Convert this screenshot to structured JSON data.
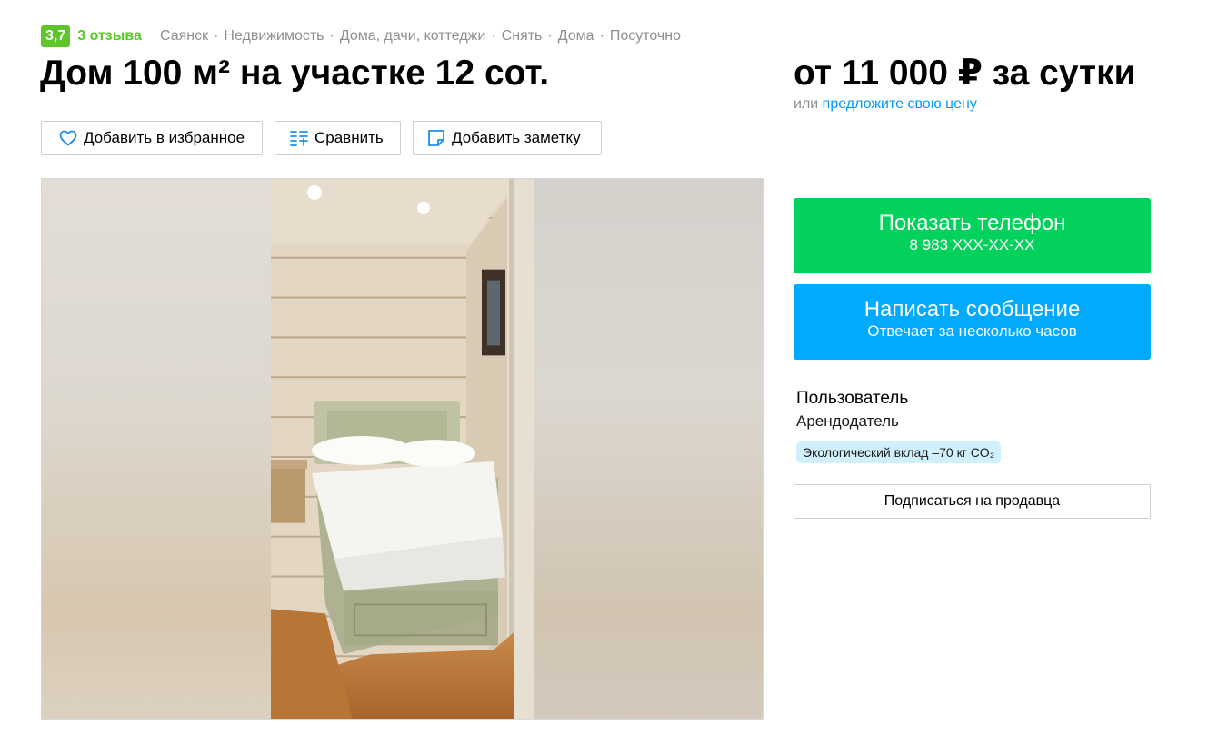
{
  "header": {
    "rating": "3,7",
    "reviews": "3 отзыва",
    "breadcrumbs": [
      "Саянск",
      "Недвижимость",
      "Дома, дачи, коттеджи",
      "Снять",
      "Дома",
      "Посуточно"
    ],
    "breadcrumb_separator": "·",
    "title": "Дом 100 м² на участке 12 сот."
  },
  "price": {
    "main": "от 11 000 ₽ за сутки",
    "or_text": "или",
    "offer_link": "предложите свою цену"
  },
  "actions": {
    "favorite": "Добавить в избранное",
    "compare": "Сравнить",
    "note": "Добавить заметку"
  },
  "contact": {
    "phone_label": "Показать телефон",
    "phone_number": "8 983 XXX-XX-XX",
    "message_label": "Написать сообщение",
    "message_sub": "Отвечает за несколько часов"
  },
  "seller": {
    "name": "Пользователь",
    "role": "Арендодатель",
    "eco_badge": "Экологический вклад –70 кг CO₂",
    "subscribe": "Подписаться на продавца"
  },
  "colors": {
    "accent_green": "#02d15c",
    "accent_blue": "#00aaff",
    "rating_green": "#5ec52a",
    "link_blue": "#0099f7"
  },
  "icons": {
    "favorite": "heart-icon",
    "compare": "compare-icon",
    "note": "note-icon"
  }
}
